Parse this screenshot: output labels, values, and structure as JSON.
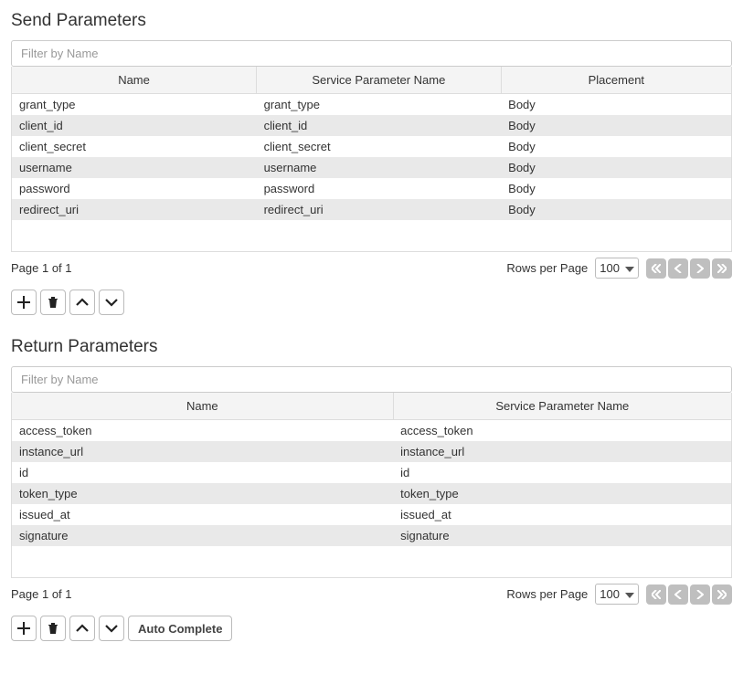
{
  "send": {
    "title": "Send Parameters",
    "filter_placeholder": "Filter by Name",
    "columns": {
      "name": "Name",
      "service": "Service Parameter Name",
      "placement": "Placement"
    },
    "rows": [
      {
        "name": "grant_type",
        "service": "grant_type",
        "placement": "Body"
      },
      {
        "name": "client_id",
        "service": "client_id",
        "placement": "Body"
      },
      {
        "name": "client_secret",
        "service": "client_secret",
        "placement": "Body"
      },
      {
        "name": "username",
        "service": "username",
        "placement": "Body"
      },
      {
        "name": "password",
        "service": "password",
        "placement": "Body"
      },
      {
        "name": "redirect_uri",
        "service": "redirect_uri",
        "placement": "Body"
      }
    ],
    "page_label": "Page 1 of 1",
    "rows_per_page_label": "Rows per Page",
    "rows_per_page_value": "100"
  },
  "return": {
    "title": "Return Parameters",
    "filter_placeholder": "Filter by Name",
    "columns": {
      "name": "Name",
      "service": "Service Parameter Name"
    },
    "rows": [
      {
        "name": "access_token",
        "service": "access_token"
      },
      {
        "name": "instance_url",
        "service": "instance_url"
      },
      {
        "name": "id",
        "service": "id"
      },
      {
        "name": "token_type",
        "service": "token_type"
      },
      {
        "name": "issued_at",
        "service": "issued_at"
      },
      {
        "name": "signature",
        "service": "signature"
      }
    ],
    "page_label": "Page 1 of 1",
    "rows_per_page_label": "Rows per Page",
    "rows_per_page_value": "100",
    "auto_complete_label": "Auto Complete"
  }
}
